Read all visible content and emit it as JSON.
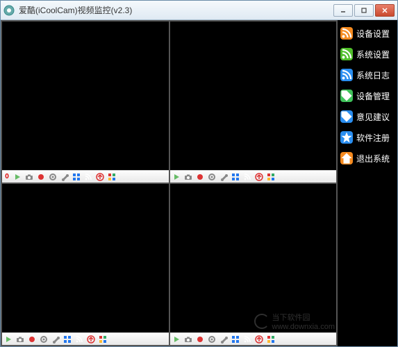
{
  "window": {
    "title": "爱酷(iCoolCam)视频监控(v2.3)"
  },
  "sidebar": {
    "items": [
      {
        "label": "设备设置",
        "icon": "rss-icon",
        "color": "#f58a1f"
      },
      {
        "label": "系统设置",
        "icon": "rss-icon",
        "color": "#4fbf2a"
      },
      {
        "label": "系统日志",
        "icon": "rss-icon",
        "color": "#2a8ef0"
      },
      {
        "label": "设备管理",
        "icon": "tag-icon",
        "color": "#3fc25a"
      },
      {
        "label": "意见建议",
        "icon": "tag-icon",
        "color": "#2a8ef0"
      },
      {
        "label": "软件注册",
        "icon": "star-icon",
        "color": "#2a8ef0"
      },
      {
        "label": "退出系统",
        "icon": "home-icon",
        "color": "#f58a1f"
      }
    ]
  },
  "cameras": {
    "count": 4,
    "cells": [
      {
        "index": "0"
      },
      {
        "index": ""
      },
      {
        "index": ""
      },
      {
        "index": ""
      }
    ],
    "toolbar_icons": [
      {
        "name": "play-icon",
        "color": "#6b6"
      },
      {
        "name": "camera-icon",
        "color": "#888"
      },
      {
        "name": "record-icon",
        "color": "#d33"
      },
      {
        "name": "gear-icon",
        "color": "#888"
      },
      {
        "name": "wrench-icon",
        "color": "#888"
      },
      {
        "name": "fullscreen-icon",
        "color": "#27e"
      },
      {
        "name": "feed-icon",
        "color": "#f58a1f"
      },
      {
        "name": "upload-icon",
        "color": "#d33"
      },
      {
        "name": "grid-icon",
        "color": "#333"
      }
    ]
  },
  "watermark": {
    "text1": "当下软件园",
    "text2": "www.downxia.com"
  }
}
